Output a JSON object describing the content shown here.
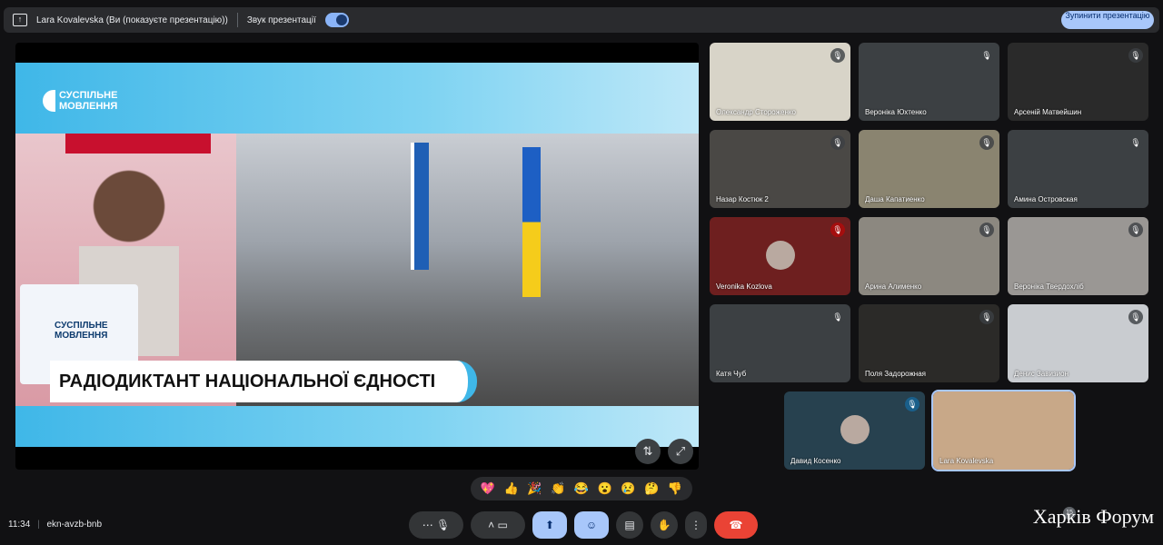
{
  "topbar": {
    "presenter": "Lara Kovalevska (Ви (показуєте презентацію))",
    "audio_label": "Звук презентації",
    "stop_button": "Зупинити презентацію",
    "audio_enabled": true
  },
  "slide": {
    "logo": "СУСПІЛЬНЕ МОВЛЕННЯ",
    "card_logo": "СУСПІЛЬНЕ МОВЛЕННЯ",
    "caption": "РАДІОДИКТАНТ НАЦІОНАЛЬНОЇ ЄДНОСТІ"
  },
  "participants": [
    {
      "name": "Олександр Стороженко",
      "bg": "#d8d4c8"
    },
    {
      "name": "Вероніка Юхтенко",
      "bg": "#3c4043"
    },
    {
      "name": "Арсеній Матвейшин",
      "bg": "#2a2a2a"
    },
    {
      "name": "Назар Костюк 2",
      "bg": "#4a4845"
    },
    {
      "name": "Даша Капатиенко",
      "bg": "#8a8470"
    },
    {
      "name": "Амина Островская",
      "bg": "#3c4043"
    },
    {
      "name": "Veronika Kozlova",
      "bg": "#6e1f1f"
    },
    {
      "name": "Арина Алименко",
      "bg": "#8c8880"
    },
    {
      "name": "Вероніка Твердохліб",
      "bg": "#9a9794"
    },
    {
      "name": "Катя Чуб",
      "bg": "#3c4043"
    },
    {
      "name": "Поля Задорожная",
      "bg": "#2b2a28"
    },
    {
      "name": "Денис Завизион",
      "bg": "#c9ccd0"
    },
    {
      "name": "Давид Косенко",
      "bg": "#27414f"
    },
    {
      "name": "Lara Kovalevska",
      "bg": "#c8a888"
    }
  ],
  "reactions": [
    "💖",
    "👍",
    "🎉",
    "👏",
    "😂",
    "😮",
    "😢",
    "🤔",
    "👎"
  ],
  "footer": {
    "time": "11:34",
    "meeting_code": "ekn-avzb-bnb",
    "participants_count": "15",
    "watermark": "Харків Форум"
  },
  "colors": {
    "accent": "#a8c7fa",
    "end_call": "#ea4335"
  }
}
